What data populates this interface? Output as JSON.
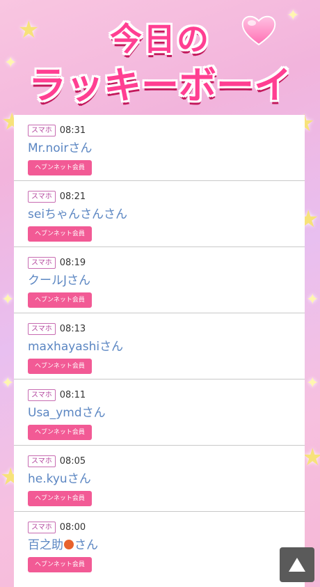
{
  "header": {
    "title_line1": "今日の",
    "title_line2": "ラッキーボーイ"
  },
  "entries": [
    {
      "device": "スマホ",
      "time": "08:31",
      "name": "Mr.noirさん",
      "button": "ヘブンネット会員"
    },
    {
      "device": "スマホ",
      "time": "08:21",
      "name": "seiちゃんさんさん",
      "button": "ヘブンネット会員"
    },
    {
      "device": "スマホ",
      "time": "08:19",
      "name": "クールJさん",
      "button": "ヘブンネット会員"
    },
    {
      "device": "スマホ",
      "time": "08:13",
      "name": "maxhayashiさん",
      "button": "ヘブンネット会員"
    },
    {
      "device": "スマホ",
      "time": "08:11",
      "name": "Usa_ymdさん",
      "button": "ヘブンネット会員"
    },
    {
      "device": "スマホ",
      "time": "08:05",
      "name": "he.kyuさん",
      "button": "ヘブンネット会員"
    },
    {
      "device": "スマホ",
      "time": "08:00",
      "name_prefix": "百之助",
      "name_suffix": "さん",
      "name_icon": "peach-icon",
      "button": "ヘブンネット会員"
    }
  ],
  "scroll_top_icon": "up-triangle-icon"
}
